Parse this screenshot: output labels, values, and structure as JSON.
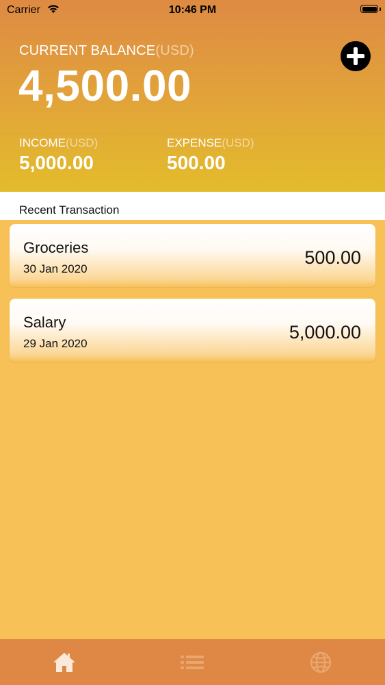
{
  "status_bar": {
    "carrier": "Carrier",
    "time": "10:46 PM"
  },
  "header": {
    "balance_label": "CURRENT BALANCE",
    "balance_currency": "(USD)",
    "balance_value": "4,500.00",
    "add_button_icon": "plus-circle-icon",
    "income": {
      "label": "INCOME",
      "currency": "(USD)",
      "value": "5,000.00"
    },
    "expense": {
      "label": "EXPENSE",
      "currency": "(USD)",
      "value": "500.00"
    }
  },
  "section": {
    "title": "Recent Transaction"
  },
  "transactions": [
    {
      "title": "Groceries",
      "date": "30 Jan 2020",
      "amount": "500.00"
    },
    {
      "title": "Salary",
      "date": "29 Jan 2020",
      "amount": "5,000.00"
    }
  ],
  "tab_bar": {
    "items": [
      {
        "icon": "home-icon",
        "active": true
      },
      {
        "icon": "list-icon",
        "active": false
      },
      {
        "icon": "globe-icon",
        "active": false
      }
    ]
  },
  "colors": {
    "header_top": "#de8a43",
    "header_bottom": "#e3bc2b",
    "body_background": "#f8c158",
    "tab_bar": "#df8745"
  }
}
